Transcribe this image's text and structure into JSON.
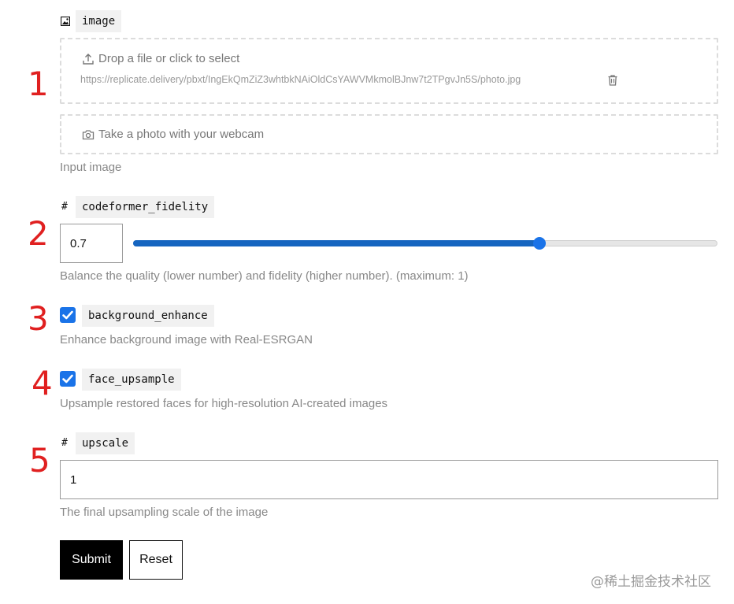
{
  "annotations": [
    "1",
    "2",
    "3",
    "4",
    "5"
  ],
  "image_field": {
    "type_icon": "image-icon",
    "name": "image",
    "dropzone_label": "Drop a file or click to select",
    "file_url": "https://replicate.delivery/pbxt/IngEkQmZiZ3whtbkNAiOldCsYAWVMkmolBJnw7t2TPgvJn5S/photo.jpg",
    "webcam_label": "Take a photo with your webcam",
    "description": "Input image"
  },
  "fidelity_field": {
    "type_symbol": "#",
    "name": "codeformer_fidelity",
    "value": "0.7",
    "slider_fraction": 0.7,
    "description": "Balance the quality (lower number) and fidelity (higher number). (maximum: 1)"
  },
  "background_field": {
    "name": "background_enhance",
    "checked": true,
    "description": "Enhance background image with Real-ESRGAN"
  },
  "face_field": {
    "name": "face_upsample",
    "checked": true,
    "description": "Upsample restored faces for high-resolution AI-created images"
  },
  "upscale_field": {
    "type_symbol": "#",
    "name": "upscale",
    "value": "1",
    "description": "The final upsampling scale of the image"
  },
  "actions": {
    "submit_label": "Submit",
    "reset_label": "Reset"
  },
  "watermark": "@稀土掘金技术社区",
  "colors": {
    "accent": "#1a73e8",
    "annotation": "#e02020",
    "submit_bg": "#000000"
  }
}
